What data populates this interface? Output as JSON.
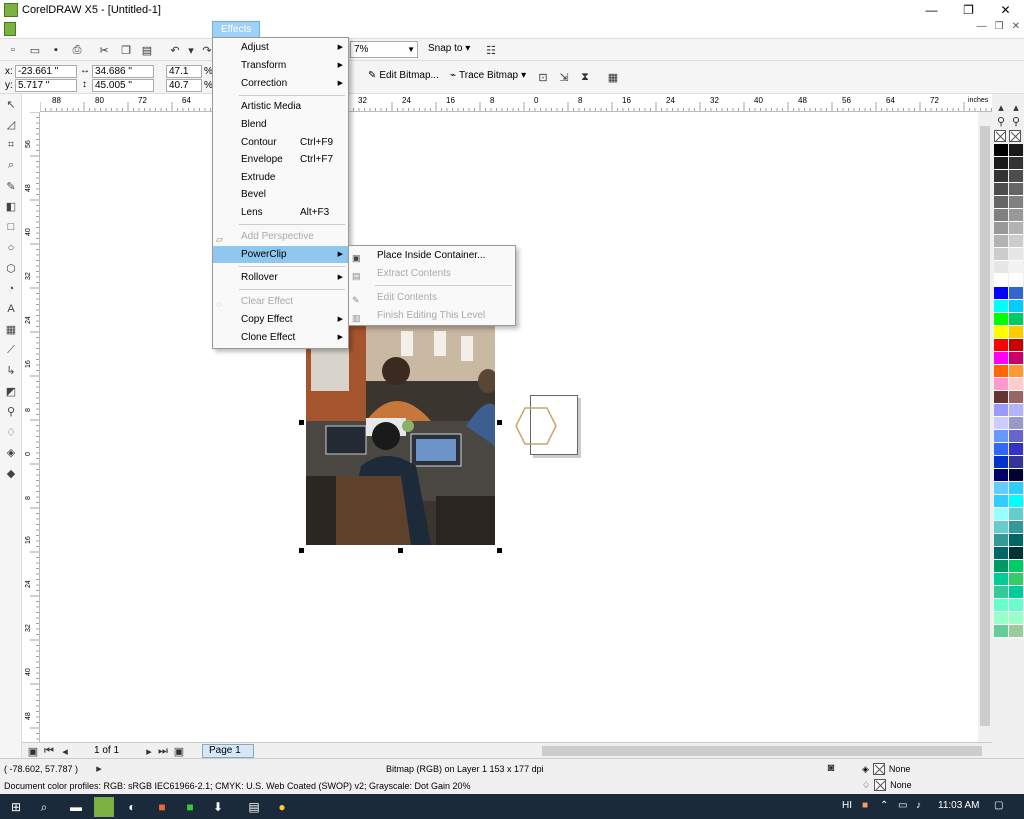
{
  "window": {
    "title": "CorelDRAW X5 - [Untitled-1]",
    "buttons": [
      "—",
      "❐",
      "✕"
    ]
  },
  "menubar": {
    "open_menu": "Effects",
    "mdi_buttons": [
      "—",
      "❐",
      "✕"
    ]
  },
  "toolbar": {
    "zoom": "7%",
    "snap_to": "Snap to"
  },
  "property_bar": {
    "x_label": "x:",
    "x_value": "-23.661 \"",
    "y_label": "y:",
    "y_value": "5.717 \"",
    "w_value": "34.686 \"",
    "h_value": "45.005 \"",
    "sx_value": "47.1",
    "sy_value": "40.7",
    "pct": "%",
    "edit_bitmap": "Edit Bitmap...",
    "trace_bitmap": "Trace Bitmap"
  },
  "ruler": {
    "top_ticks": [
      "88",
      "80",
      "72",
      "64",
      "32",
      "24",
      "16",
      "8",
      "0",
      "8",
      "16",
      "24",
      "32",
      "40",
      "48",
      "56",
      "64",
      "72"
    ],
    "units": "inches",
    "left_ticks": [
      "56",
      "48",
      "40",
      "32",
      "24",
      "16",
      "8",
      "0",
      "8",
      "16",
      "24",
      "32",
      "40",
      "48"
    ]
  },
  "effects_menu": {
    "items": [
      {
        "label": "Adjust",
        "shortcut": "",
        "submenu": true,
        "disabled": false
      },
      {
        "label": "Transform",
        "shortcut": "",
        "submenu": true,
        "disabled": false
      },
      {
        "label": "Correction",
        "shortcut": "",
        "submenu": true,
        "disabled": false
      },
      {
        "label": "Artistic Media",
        "shortcut": "",
        "submenu": false,
        "disabled": false
      },
      {
        "label": "Blend",
        "shortcut": "",
        "submenu": false,
        "disabled": false
      },
      {
        "label": "Contour",
        "shortcut": "Ctrl+F9",
        "submenu": false,
        "disabled": false
      },
      {
        "label": "Envelope",
        "shortcut": "Ctrl+F7",
        "submenu": false,
        "disabled": false
      },
      {
        "label": "Extrude",
        "shortcut": "",
        "submenu": false,
        "disabled": false
      },
      {
        "label": "Bevel",
        "shortcut": "",
        "submenu": false,
        "disabled": false
      },
      {
        "label": "Lens",
        "shortcut": "Alt+F3",
        "submenu": false,
        "disabled": false
      },
      {
        "label": "Add Perspective",
        "shortcut": "",
        "submenu": false,
        "disabled": true
      },
      {
        "label": "PowerClip",
        "shortcut": "",
        "submenu": true,
        "disabled": false,
        "highlighted": true
      },
      {
        "label": "Rollover",
        "shortcut": "",
        "submenu": true,
        "disabled": false
      },
      {
        "label": "Clear Effect",
        "shortcut": "",
        "submenu": false,
        "disabled": true
      },
      {
        "label": "Copy Effect",
        "shortcut": "",
        "submenu": true,
        "disabled": false
      },
      {
        "label": "Clone Effect",
        "shortcut": "",
        "submenu": true,
        "disabled": false
      }
    ]
  },
  "powerclip_menu": {
    "items": [
      {
        "label": "Place Inside Container...",
        "disabled": false
      },
      {
        "label": "Extract Contents",
        "disabled": true
      },
      {
        "label": "Edit Contents",
        "disabled": true
      },
      {
        "label": "Finish Editing This Level",
        "disabled": true
      }
    ]
  },
  "page_nav": {
    "page_count": "1 of 1",
    "page_tab": "Page 1"
  },
  "status": {
    "coords": "( -78.602, 57.787 )",
    "object_info": "Bitmap (RGB) on Layer 1 153 x 177 dpi",
    "color_profiles": "Document color profiles: RGB: sRGB IEC61966-2.1; CMYK: U.S. Web Coated (SWOP) v2; Grayscale: Dot Gain 20%",
    "fill": "None",
    "outline": "None"
  },
  "taskbar": {
    "time": "11:03 AM",
    "lang": "HI"
  },
  "palette": {
    "left": [
      "#000000",
      "#1a1a1a",
      "#333333",
      "#4d4d4d",
      "#666666",
      "#808080",
      "#999999",
      "#b3b3b3",
      "#cccccc",
      "#e6e6e6",
      "#ffffff",
      "#0000ff",
      "#00ffff",
      "#00ff00",
      "#ffff00",
      "#ff0000",
      "#ff00ff",
      "#ff6600",
      "#ff99cc",
      "#663333",
      "#9999ff",
      "#ccccff",
      "#6699ff",
      "#3366ff",
      "#0033cc",
      "#000066",
      "#66ccff",
      "#33ccff",
      "#99ffff",
      "#66cccc",
      "#339999",
      "#006666",
      "#009966",
      "#00cc99",
      "#33cc99",
      "#66ffcc",
      "#99ffcc",
      "#66cc99"
    ],
    "right": [
      "#1a1a1a",
      "#333333",
      "#4d4d4d",
      "#666666",
      "#808080",
      "#999999",
      "#b3b3b3",
      "#cccccc",
      "#e6e6e6",
      "#f2f2f2",
      "#ffffff",
      "#3366cc",
      "#00ccff",
      "#00cc66",
      "#ffcc00",
      "#cc0000",
      "#cc0066",
      "#ff9933",
      "#ffcccc",
      "#996666",
      "#b3b3ff",
      "#9999cc",
      "#6666cc",
      "#3333cc",
      "#333399",
      "#000033",
      "#33ccff",
      "#00ffff",
      "#66cccc",
      "#339999",
      "#006666",
      "#003333",
      "#00cc66",
      "#33cc66",
      "#00cc99",
      "#66ffcc",
      "#99ffcc",
      "#99cc99"
    ]
  }
}
